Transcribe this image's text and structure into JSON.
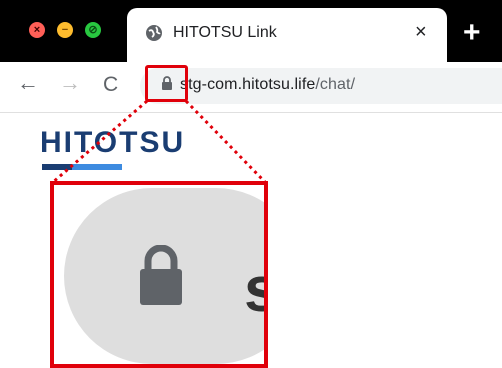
{
  "window": {
    "controls": {
      "close_glyph": "×",
      "minimize_glyph": "−",
      "maximize_glyph": "⊘"
    },
    "tab": {
      "title": "HITOTSU Link",
      "close_glyph": "×",
      "icon": "globe-icon"
    },
    "new_tab_glyph": "+"
  },
  "toolbar": {
    "back_glyph": "←",
    "forward_glyph": "→",
    "reload_glyph": "C",
    "url_host": "stg-com.hitotsu.life",
    "url_path": "/chat/",
    "lock_icon": "lock-icon"
  },
  "page": {
    "logo_text": "HITOTSU"
  },
  "callout": {
    "highlight_color": "#e0000a",
    "zoom_char": "s"
  }
}
